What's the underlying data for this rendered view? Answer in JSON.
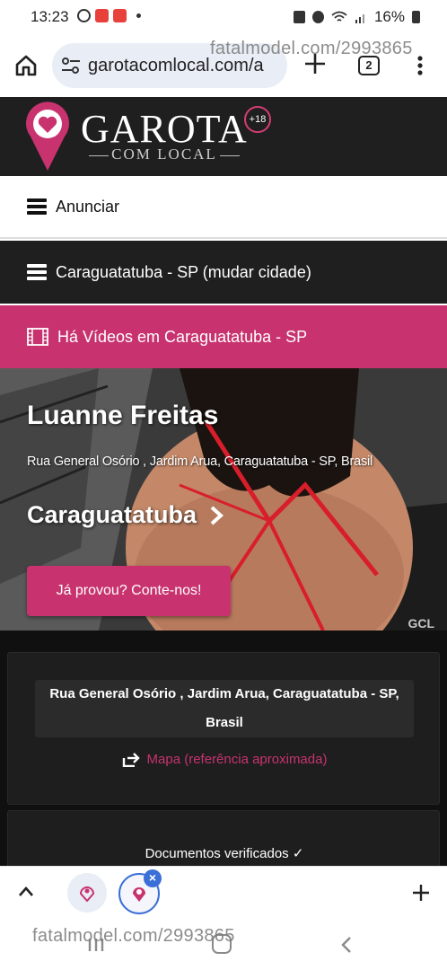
{
  "status_bar": {
    "time": "13:23",
    "battery": "16%"
  },
  "browser": {
    "url": "garotacomlocal.com/a",
    "tab_count": "2",
    "watermark": "fatalmodel.com/2993865"
  },
  "site": {
    "logo_title": "GAROTA",
    "logo_subtitle": "COM LOCAL",
    "logo_badge": "+18"
  },
  "nav": {
    "anunciar": "Anunciar",
    "city": "Caraguatatuba - SP (mudar cidade)",
    "videos": "Há Vídeos em Caraguatatuba - SP"
  },
  "hero": {
    "name": "Luanne Freitas",
    "address": "Rua General Osório , Jardim Arua, Caraguatatuba - SP, Brasil",
    "city": "Caraguatatuba",
    "button": "Já provou? Conte-nos!",
    "gcl": "GCL"
  },
  "details": {
    "address_line1": "Rua General Osório , Jardim Arua, Caraguatatuba - SP,",
    "address_line2": "Brasil",
    "map_link": "Mapa (referência aproximada)",
    "documents": "Documentos verificados ✓"
  },
  "bottom_watermark": "fatalmodel.com/2993865",
  "colors": {
    "brand_pink": "#c8336f",
    "dark_bg": "#1f1f1f",
    "link_blue": "#3b6fd8"
  }
}
